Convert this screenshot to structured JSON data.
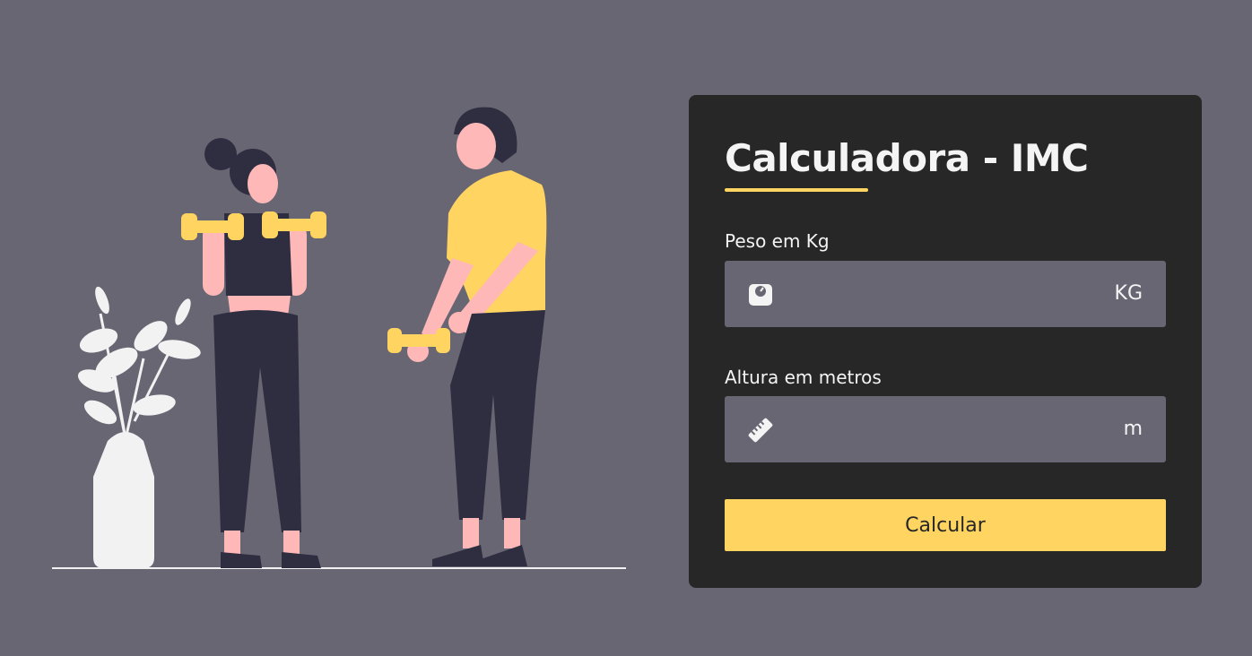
{
  "colors": {
    "background": "#696673",
    "card": "#272727",
    "accent": "#ffd460",
    "text": "#f4f4f4",
    "skin": "#ffb8b8",
    "dark_clothes": "#2f2e41",
    "plant": "#f2f2f2"
  },
  "illustration": {
    "icon": "fitness-people-illustration"
  },
  "form": {
    "title": "Calculadora - IMC",
    "weight": {
      "label": "Peso em Kg",
      "value": "",
      "unit": "KG",
      "icon": "scale-icon"
    },
    "height": {
      "label": "Altura em metros",
      "value": "",
      "unit": "m",
      "icon": "ruler-icon"
    },
    "submit_label": "Calcular"
  }
}
